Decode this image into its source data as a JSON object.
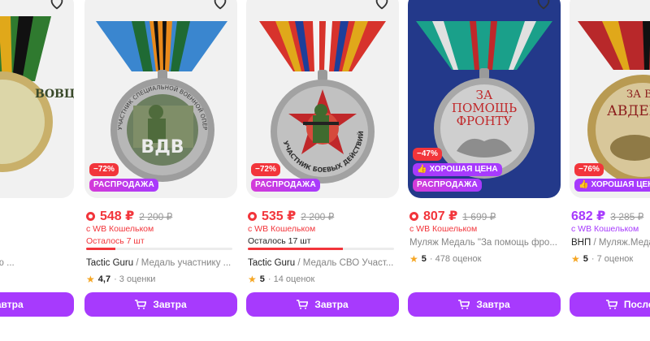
{
  "cards": [
    {
      "old_price": "₽",
      "title_text": "Медаль За ратную ...",
      "button_label": "Завтра"
    },
    {
      "discount": "−72%",
      "sale": "РАСПРОДАЖА",
      "price": "548 ₽",
      "old_price": "2 200 ₽",
      "wallet": "с WB Кошельком",
      "remaining": "Осталось 7 шт",
      "remaining_fraction": 0.2,
      "brand": "Tactic Guru",
      "title_text": " / Медаль участнику ...",
      "rating": "4,7",
      "reviews": "· 3 оценки",
      "button_label": "Завтра",
      "medal_text": "ВДВ",
      "medal_ring": "УЧАСТНИК СПЕЦИАЛЬНОЙ ВОЕННОЙ ОПЕРАЦИИ"
    },
    {
      "discount": "−72%",
      "sale": "РАСПРОДАЖА",
      "price": "535 ₽",
      "old_price": "2 200 ₽",
      "wallet": "с WB Кошельком",
      "remaining": "Осталось 17 шт",
      "remaining_fraction": 0.65,
      "brand": "Tactic Guru",
      "title_text": " / Медаль СВО Участ...",
      "rating": "5",
      "reviews": "· 14 оценок",
      "button_label": "Завтра",
      "medal_ring": "УЧАСТНИК БОЕВЫХ ДЕЙСТВИЙ"
    },
    {
      "discount": "−47%",
      "good_price": "ХОРОШАЯ ЦЕНА",
      "sale": "РАСПРОДАЖА",
      "price": "807 ₽",
      "old_price": "1 699 ₽",
      "wallet": "с WB Кошельком",
      "title_text": "Муляж Медаль \"За помощь фро...",
      "rating": "5",
      "reviews": "· 478 оценок",
      "button_label": "Завтра",
      "medal_line1": "ЗА",
      "medal_line2": "ПОМОЩЬ",
      "medal_line3": "ФРОНТУ"
    },
    {
      "discount": "−76%",
      "good_price": "ХОРОШАЯ ЦЕНА",
      "price": "682 ₽",
      "old_price": "3 285 ₽",
      "wallet": "с WB Кошельком",
      "brand": "ВНП",
      "title_text": " / Муляж.Медаль...",
      "rating": "5",
      "reviews": "· 7 оценок",
      "button_label": "Послезавтра",
      "medal_line1": "ЗА ВЗЯТИЕ",
      "medal_line2": "АВДЕЕВКИ"
    }
  ],
  "colors": {
    "accent": "#a73afd",
    "discount": "#f2353b",
    "rating_star": "#f5a623"
  },
  "icons": [
    "heart-icon",
    "cart-icon",
    "thumbs-up-icon",
    "star-icon",
    "wallet-dot-icon"
  ]
}
